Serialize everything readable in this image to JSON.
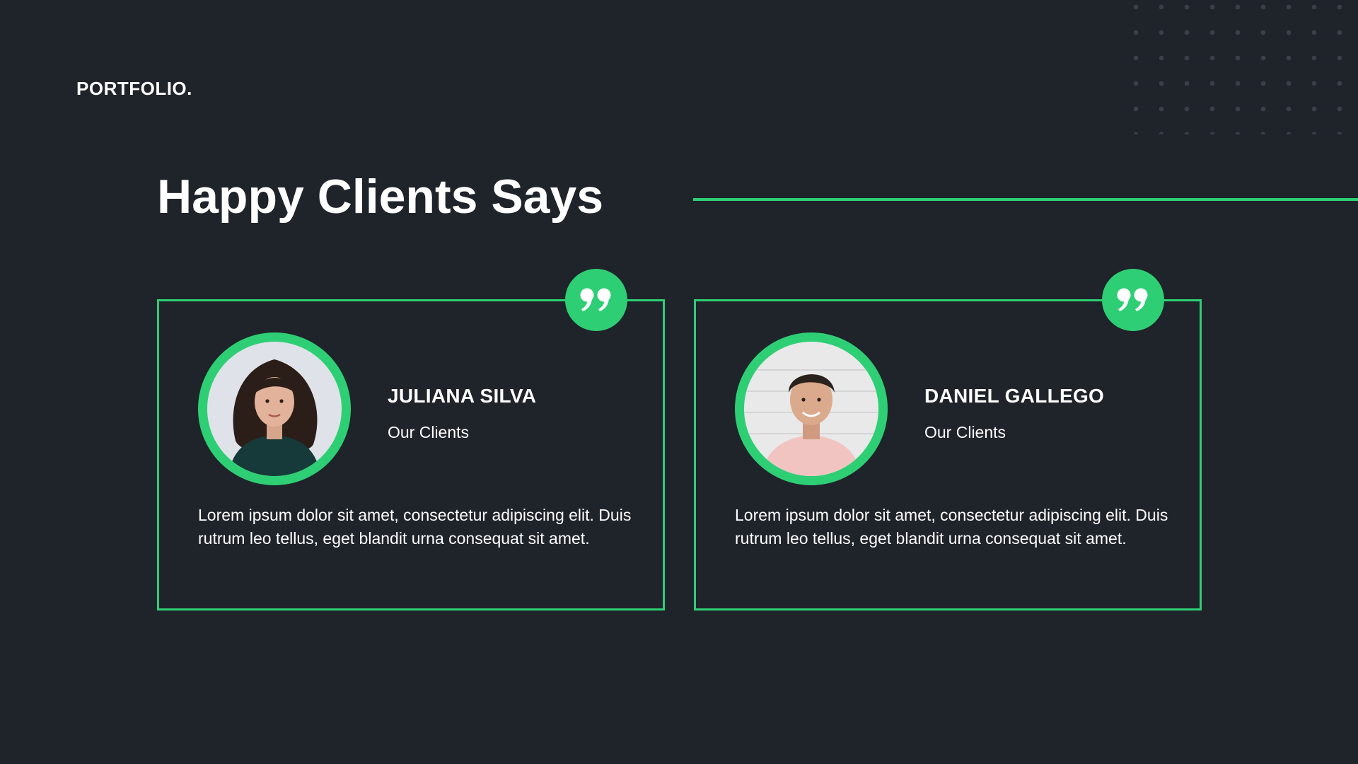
{
  "brand": {
    "logo_text": "PORTFOLIO."
  },
  "section": {
    "title": "Happy Clients Says"
  },
  "testimonials": [
    {
      "name": "JULIANA SILVA",
      "role": "Our Clients",
      "text": "Lorem ipsum dolor sit amet, consectetur adipiscing elit. Duis rutrum leo tellus, eget blandit urna consequat sit amet.",
      "quote_icon": "quote-icon",
      "avatar_icon": "avatar-photo-woman"
    },
    {
      "name": "DANIEL GALLEGO",
      "role": "Our Clients",
      "text": "Lorem ipsum dolor sit amet, consectetur adipiscing elit. Duis rutrum leo tellus, eget blandit urna consequat sit amet.",
      "quote_icon": "quote-icon",
      "avatar_icon": "avatar-photo-man"
    }
  ],
  "colors": {
    "background": "#1f232a",
    "accent": "#2ecf74",
    "text": "#ffffff",
    "dot_pattern": "#3a4049"
  }
}
